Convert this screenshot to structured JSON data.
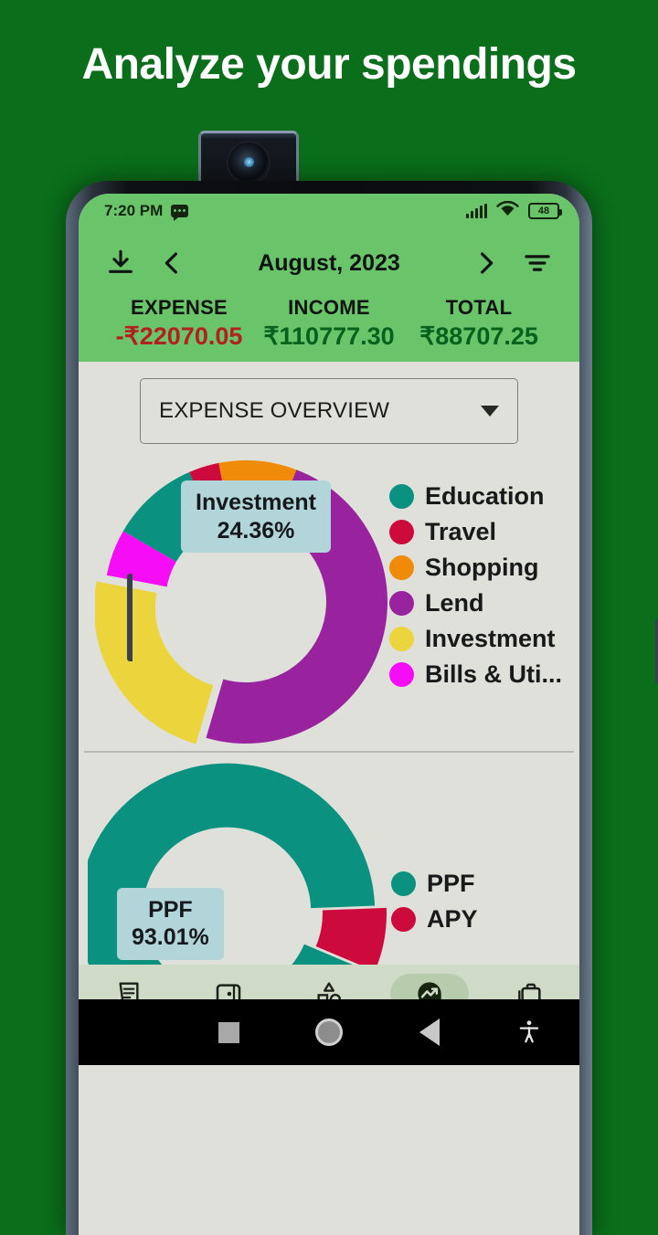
{
  "promo": {
    "headline": "Analyze your spendings"
  },
  "status_bar": {
    "time": "7:20 PM",
    "sms_icon": "sms-icon",
    "signal_icon": "cellular-signal-icon",
    "wifi_icon": "wifi-icon",
    "battery_level": "48"
  },
  "header": {
    "download_icon": "download-icon",
    "prev_icon": "chevron-left-icon",
    "title": "August, 2023",
    "next_icon": "chevron-right-icon",
    "filter_icon": "filter-icon",
    "green": "#69c46a"
  },
  "totals": [
    {
      "label": "EXPENSE",
      "value": "-₹22070.05",
      "color": "#b3211f"
    },
    {
      "label": "INCOME",
      "value": "₹110777.30",
      "color": "#06621c"
    },
    {
      "label": "TOTAL",
      "value": "₹88707.25",
      "color": "#06621c"
    }
  ],
  "selector": {
    "value": "EXPENSE OVERVIEW",
    "caret_icon": "chevron-down-icon"
  },
  "chart_data": [
    {
      "type": "pie",
      "title": "EXPENSE OVERVIEW",
      "variant": "donut",
      "legend_position": "right",
      "categories": [
        "Education",
        "Travel",
        "Shopping",
        "Lend",
        "Investment",
        "Bills & Uti..."
      ],
      "values": [
        10.5,
        3.6,
        9.2,
        50.5,
        24.36,
        5.5
      ],
      "unit": "%",
      "colors": [
        "#0b9180",
        "#cc0a3c",
        "#ef8b08",
        "#99239f",
        "#ecd43d",
        "#f50ef5"
      ],
      "exploded_slice": "Investment",
      "tooltip": {
        "name": "Investment",
        "value": "24.36%"
      }
    },
    {
      "type": "pie",
      "variant": "donut",
      "legend_position": "right",
      "categories": [
        "PPF",
        "APY"
      ],
      "values": [
        93.01,
        6.99
      ],
      "unit": "%",
      "colors": [
        "#0b9180",
        "#cc0a3c"
      ],
      "exploded_slice": "PPF",
      "tooltip": {
        "name": "PPF",
        "value": "93.01%"
      }
    }
  ],
  "bottom_nav": {
    "active": "Analysis",
    "items": [
      {
        "label": "Records",
        "icon": "receipt-icon"
      },
      {
        "label": "Accounts",
        "icon": "wallet-icon"
      },
      {
        "label": "Categories",
        "icon": "shapes-icon"
      },
      {
        "label": "Analysis",
        "icon": "analytics-icon"
      },
      {
        "label": "Budgets",
        "icon": "briefcase-icon"
      }
    ]
  },
  "android_nav": {
    "recents_icon": "square-recents-icon",
    "home_icon": "circle-home-icon",
    "back_icon": "triangle-back-icon",
    "accessibility_icon": "accessibility-icon"
  }
}
